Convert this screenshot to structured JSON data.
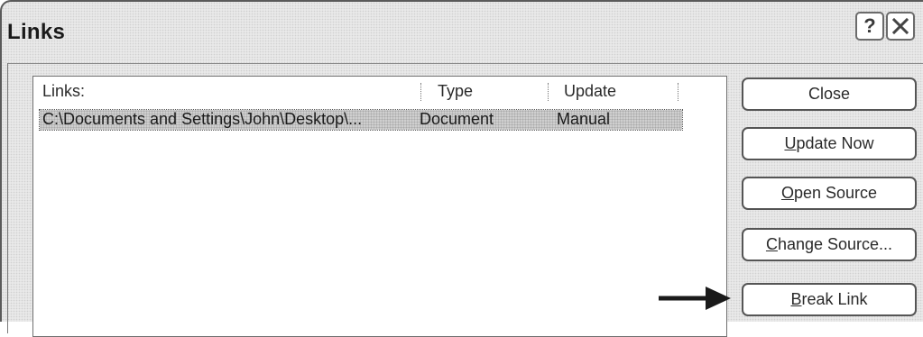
{
  "dialog": {
    "title": "Links",
    "help_label": "?",
    "close_icon": "close-x-icon"
  },
  "list": {
    "columns": [
      "Links:",
      "Type",
      "Update"
    ],
    "rows": [
      {
        "source": "C:\\Documents and Settings\\John\\Desktop\\...",
        "type": "Document",
        "update": "Manual",
        "selected": true
      }
    ]
  },
  "buttons": {
    "close": {
      "pre": "",
      "mnemonic": "",
      "post": "Close"
    },
    "update_now": {
      "pre": "",
      "mnemonic": "U",
      "post": "pdate Now"
    },
    "open_source": {
      "pre": "",
      "mnemonic": "O",
      "post": "pen Source"
    },
    "change_source": {
      "pre": "",
      "mnemonic": "C",
      "post": "hange Source..."
    },
    "break_link": {
      "pre": "",
      "mnemonic": "B",
      "post": "reak Link"
    }
  },
  "annotation": {
    "arrow_icon": "pointer-arrow-icon",
    "points_to": "Break Link"
  },
  "colors": {
    "dialog_bg": "#e9e9e9",
    "selection_bg": "#cfcfcf",
    "border": "#555555"
  }
}
